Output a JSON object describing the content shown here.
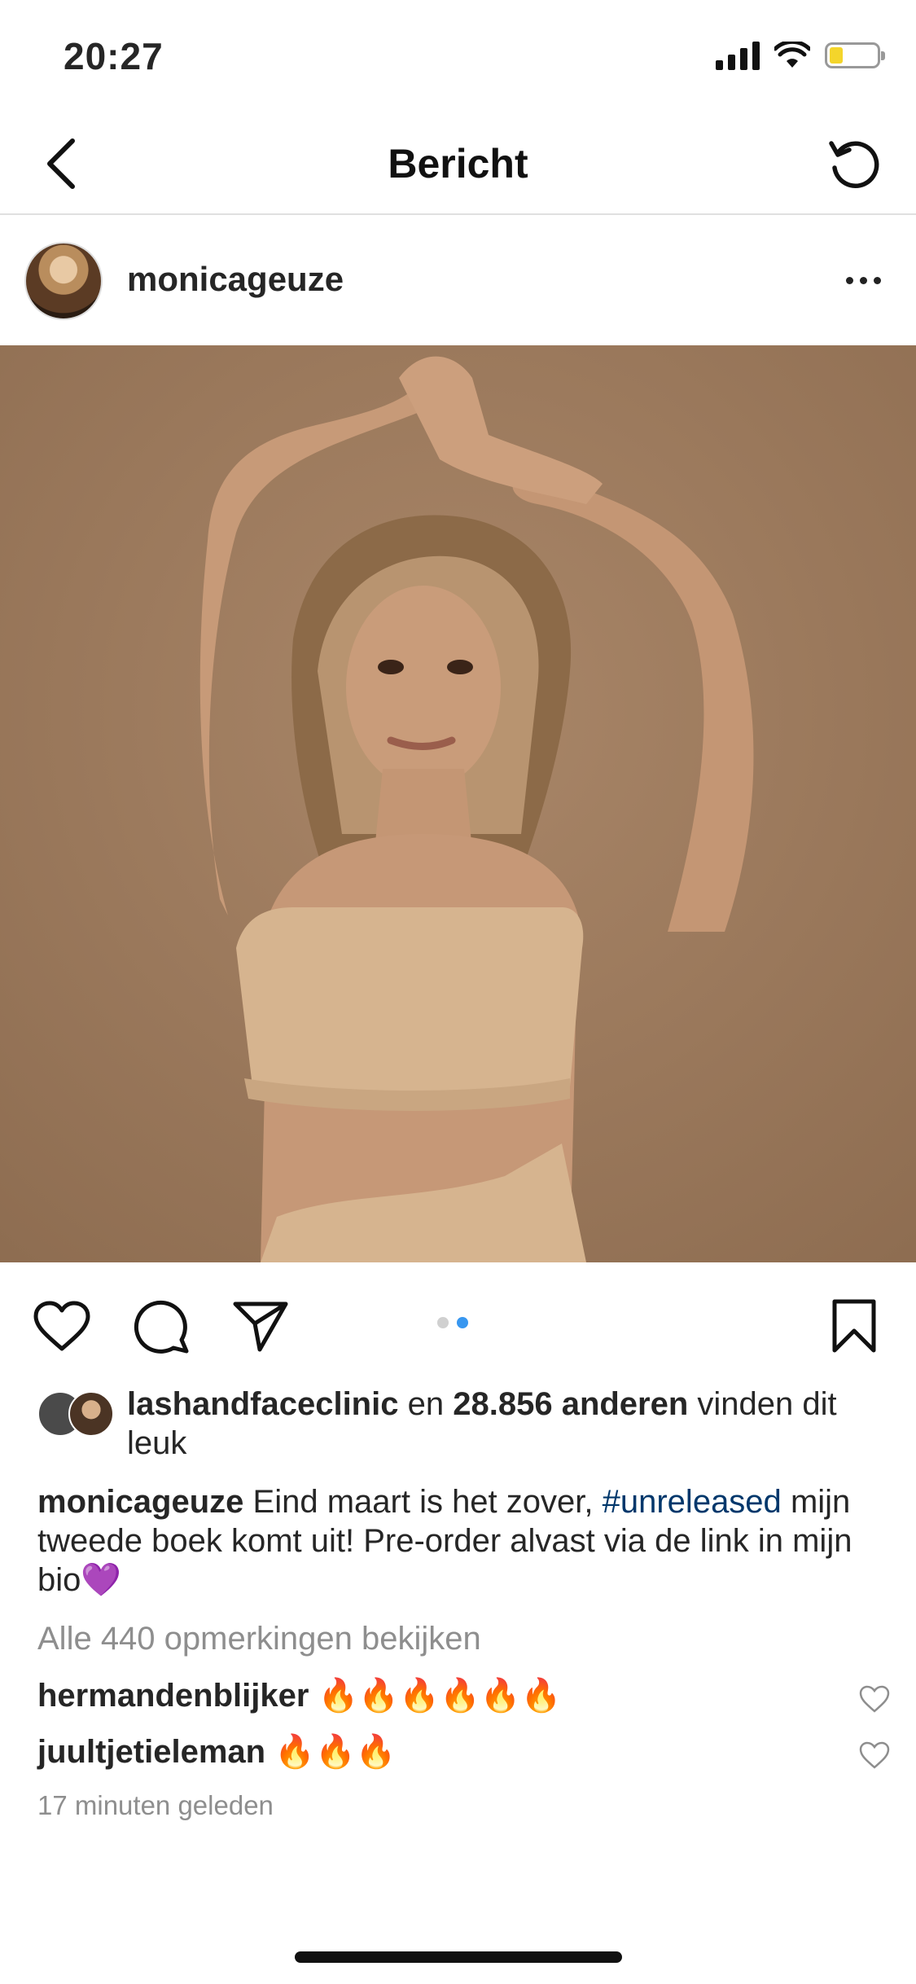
{
  "status_bar": {
    "time": "20:27"
  },
  "nav": {
    "title": "Bericht"
  },
  "post": {
    "username": "monicageuze",
    "carousel": {
      "total": 2,
      "active": 2
    },
    "likes": {
      "liker": "lashandfaceclinic",
      "connector": "en",
      "count": "28.856 anderen",
      "suffix": "vinden dit leuk"
    },
    "caption": {
      "username": "monicageuze",
      "text_before": "Eind maart is het zover,",
      "hashtag": "#unreleased",
      "text_after": "mijn tweede boek komt uit! Pre-order alvast via de link in mijn bio💜"
    },
    "view_comments": "Alle 440 opmerkingen bekijken",
    "comments": [
      {
        "username": "hermandenblijker",
        "text": "🔥🔥🔥🔥🔥🔥"
      },
      {
        "username": "juultjetieleman",
        "text": "🔥🔥🔥"
      }
    ],
    "timestamp": "17 minuten geleden"
  },
  "colors": {
    "accent_blue": "#3897f0",
    "hashtag": "#00376b",
    "muted": "#8e8e8e"
  }
}
